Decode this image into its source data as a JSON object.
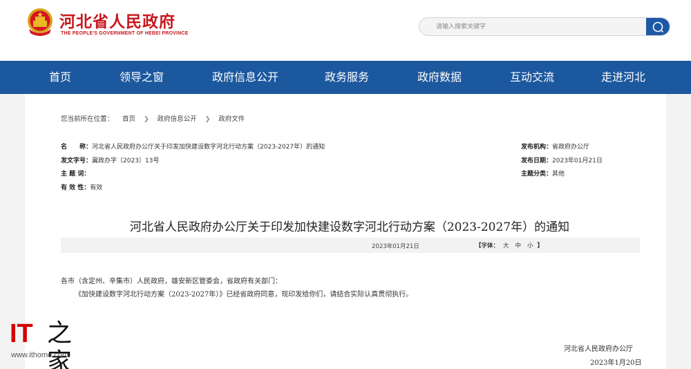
{
  "header": {
    "site_title": "河北省人民政府",
    "site_subtitle": "THE PEOPLE'S GOVERNMENT OF HEBEI PROVINCE",
    "search_placeholder": "请输入搜索关键字",
    "emblem_icon": "national-emblem-icon",
    "search_icon": "search-icon",
    "brand_color": "#c8161d"
  },
  "nav": {
    "color": "#1c589e",
    "items": [
      "首页",
      "领导之窗",
      "政府信息公开",
      "政务服务",
      "政府数据",
      "互动交流",
      "走进河北"
    ]
  },
  "breadcrumb": {
    "prefix": "您当前所在位置：",
    "items": [
      "首页",
      "政府信息公开",
      "政府文件"
    ]
  },
  "meta": {
    "name_label": "名　　称：",
    "name_value": "河北省人民政府办公厅关于印发加快建设数字河北行动方案（2023-2027年）的通知",
    "doc_no_label": "发文字号：",
    "doc_no_value": "冀政办字〔2023〕13号",
    "topic_label": "主 题 词：",
    "topic_value": "",
    "validity_label": "有 效 性：",
    "validity_value": "有效",
    "publisher_label": "发布机构：",
    "publisher_value": "省政府办公厅",
    "date_label": "发布日期：",
    "date_value": "2023年01月21日",
    "category_label": "主题分类：",
    "category_value": "其他"
  },
  "document": {
    "title": "河北省人民政府办公厅关于印发加快建设数字河北行动方案（2023-2027年）的通知",
    "date": "2023年01月21日",
    "font_label": "【字体：",
    "font_large": "大",
    "font_medium": "中",
    "font_small": "小",
    "font_close": "】",
    "salutation": "各市（含定州、辛集市）人民政府，雄安新区管委会，省政府有关部门：",
    "paragraph": "《加快建设数字河北行动方案（2023-2027年）》已经省政府同意，现印发给你们，请结合实际认真贯彻执行。",
    "signature": "河北省人民政府办公厅",
    "signature_date": "2023年1月20日"
  },
  "watermark": {
    "logo_it": "IT",
    "logo_cn": "之家",
    "url": "www.ithome.com"
  }
}
